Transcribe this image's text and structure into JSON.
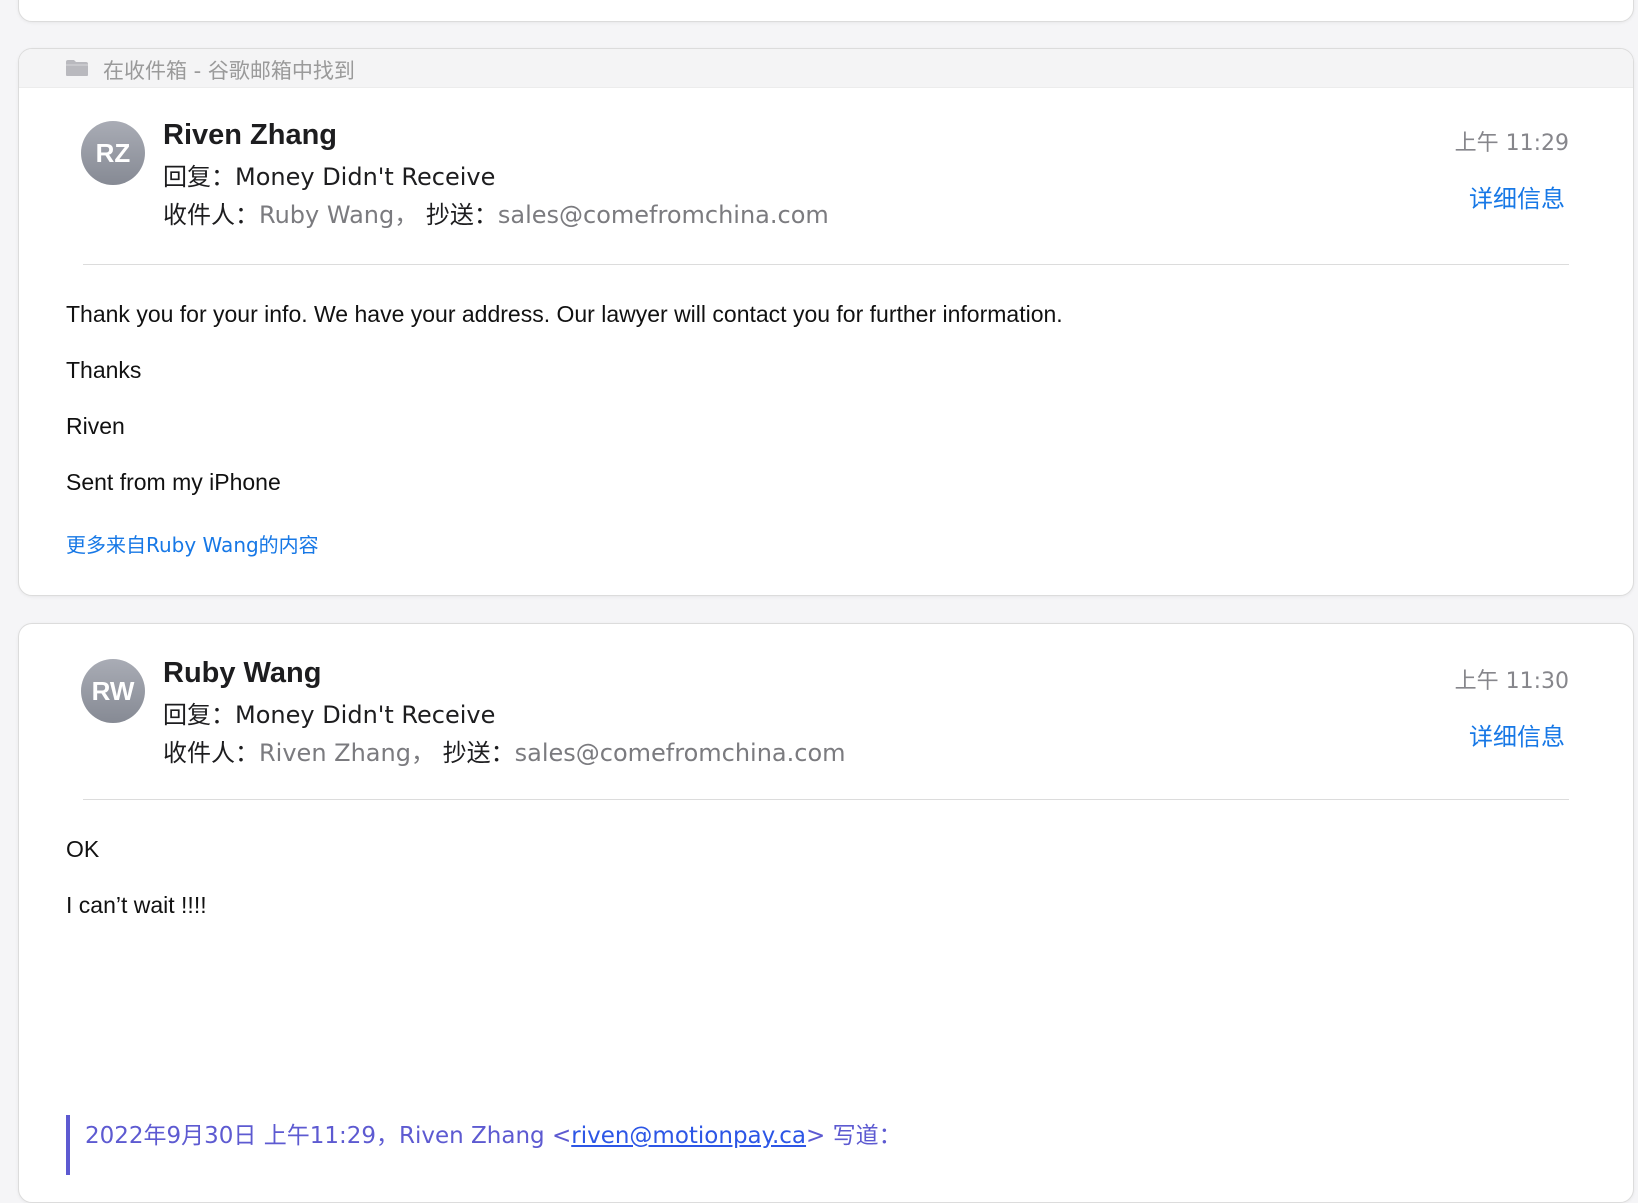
{
  "folder_banner": {
    "icon": "folder-icon",
    "label": "在收件箱 - 谷歌邮箱中找到"
  },
  "messages": [
    {
      "avatar_initials": "RZ",
      "sender": "Riven Zhang",
      "subject": "回复：Money Didn't Receive",
      "to_label": "收件人：",
      "to": "Ruby Wang，",
      "cc_label": "抄送：",
      "cc": "sales@comefromchina.com",
      "time": "上午 11:29",
      "details_label": "详细信息",
      "body": [
        "Thank you for your info. We have your address. Our lawyer will contact you for further information.",
        "Thanks",
        "Riven",
        "Sent from my iPhone"
      ],
      "more_link": "更多来自Ruby Wang的内容"
    },
    {
      "avatar_initials": "RW",
      "sender": "Ruby Wang",
      "subject": "回复：Money Didn't Receive",
      "to_label": "收件人：",
      "to": "Riven Zhang，",
      "cc_label": "抄送：",
      "cc": "sales@comefromchina.com",
      "time": "上午 11:30",
      "details_label": "详细信息",
      "body": [
        "OK",
        "I can’t wait !!!!"
      ],
      "quote": {
        "prefix": "2022年9月30日 上午11:29，Riven Zhang <",
        "email": "riven@motionpay.ca",
        "suffix": "> 写道："
      }
    }
  ],
  "colors": {
    "link": "#1778e6",
    "quote": "#5d5ad1",
    "background": "#f5f5f7"
  }
}
